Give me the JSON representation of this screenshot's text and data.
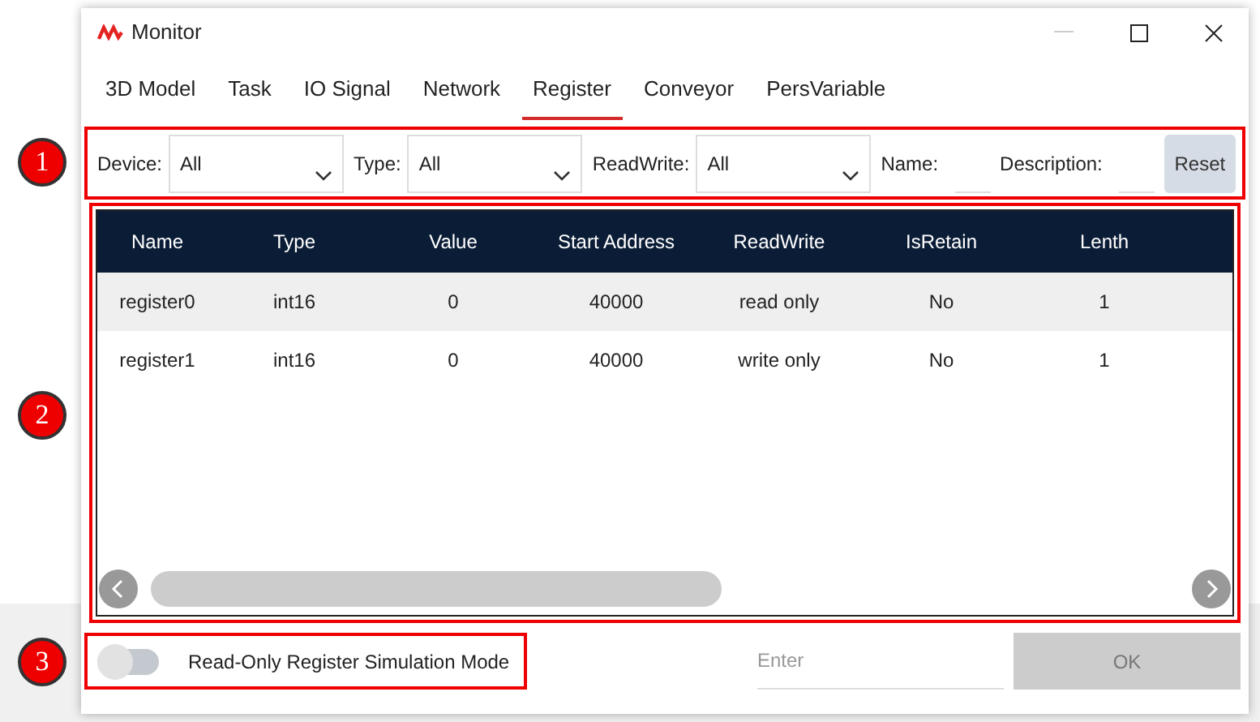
{
  "window": {
    "title": "Monitor"
  },
  "tabs": [
    {
      "label": "3D Model",
      "selected": false
    },
    {
      "label": "Task",
      "selected": false
    },
    {
      "label": "IO Signal",
      "selected": false
    },
    {
      "label": "Network",
      "selected": false
    },
    {
      "label": "Register",
      "selected": true
    },
    {
      "label": "Conveyor",
      "selected": false
    },
    {
      "label": "PersVariable",
      "selected": false
    }
  ],
  "filters": [
    {
      "kind": "select",
      "label": "Device:",
      "value": "All"
    },
    {
      "kind": "select",
      "label": "Type:",
      "value": "All"
    },
    {
      "kind": "select",
      "label": "ReadWrite:",
      "value": "All"
    },
    {
      "kind": "text",
      "label": "Name:"
    },
    {
      "kind": "text",
      "label": "Description:"
    }
  ],
  "reset_button": "Reset",
  "table": {
    "columns": [
      "Name",
      "Type",
      "Value",
      "Start Address",
      "ReadWrite",
      "IsRetain",
      "Lenth"
    ],
    "rows": [
      {
        "selected": true,
        "cells": [
          "register0",
          "int16",
          "0",
          "40000",
          "read only",
          "No",
          "1"
        ]
      },
      {
        "selected": false,
        "cells": [
          "register1",
          "int16",
          "0",
          "40000",
          "write only",
          "No",
          "1"
        ]
      }
    ]
  },
  "simulation_toggle": {
    "label": "Read-Only Register Simulation Mode",
    "on": false
  },
  "enter_field": {
    "placeholder": "Enter"
  },
  "ok_button": {
    "label": "OK",
    "disabled": true
  },
  "callouts": [
    "1",
    "2",
    "3"
  ]
}
